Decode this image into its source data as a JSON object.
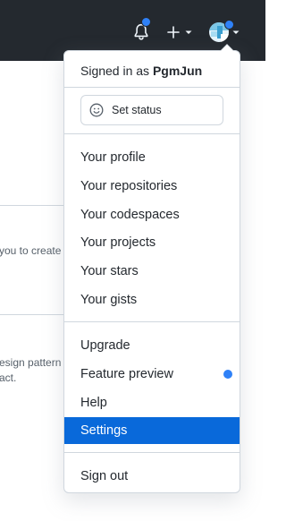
{
  "header": {
    "notifications_icon": "bell-icon",
    "create_icon": "plus-icon",
    "dropdown_icon": "caret-down-icon",
    "avatar_icon": "avatar",
    "badge_color": "#2f81f7",
    "bar_color": "#24292f"
  },
  "background": {
    "line1": "you to create",
    "line2": "esign pattern",
    "line3": "act."
  },
  "menu": {
    "signed_in_prefix": "Signed in as",
    "username": "PgmJun",
    "set_status": "Set status",
    "items_group1": [
      {
        "label": "Your profile"
      },
      {
        "label": "Your repositories"
      },
      {
        "label": "Your codespaces"
      },
      {
        "label": "Your projects"
      },
      {
        "label": "Your stars"
      },
      {
        "label": "Your gists"
      }
    ],
    "items_group2": [
      {
        "label": "Upgrade"
      },
      {
        "label": "Feature preview"
      },
      {
        "label": "Help"
      },
      {
        "label": "Settings"
      }
    ],
    "sign_out": "Sign out",
    "active_color": "#0969da"
  }
}
